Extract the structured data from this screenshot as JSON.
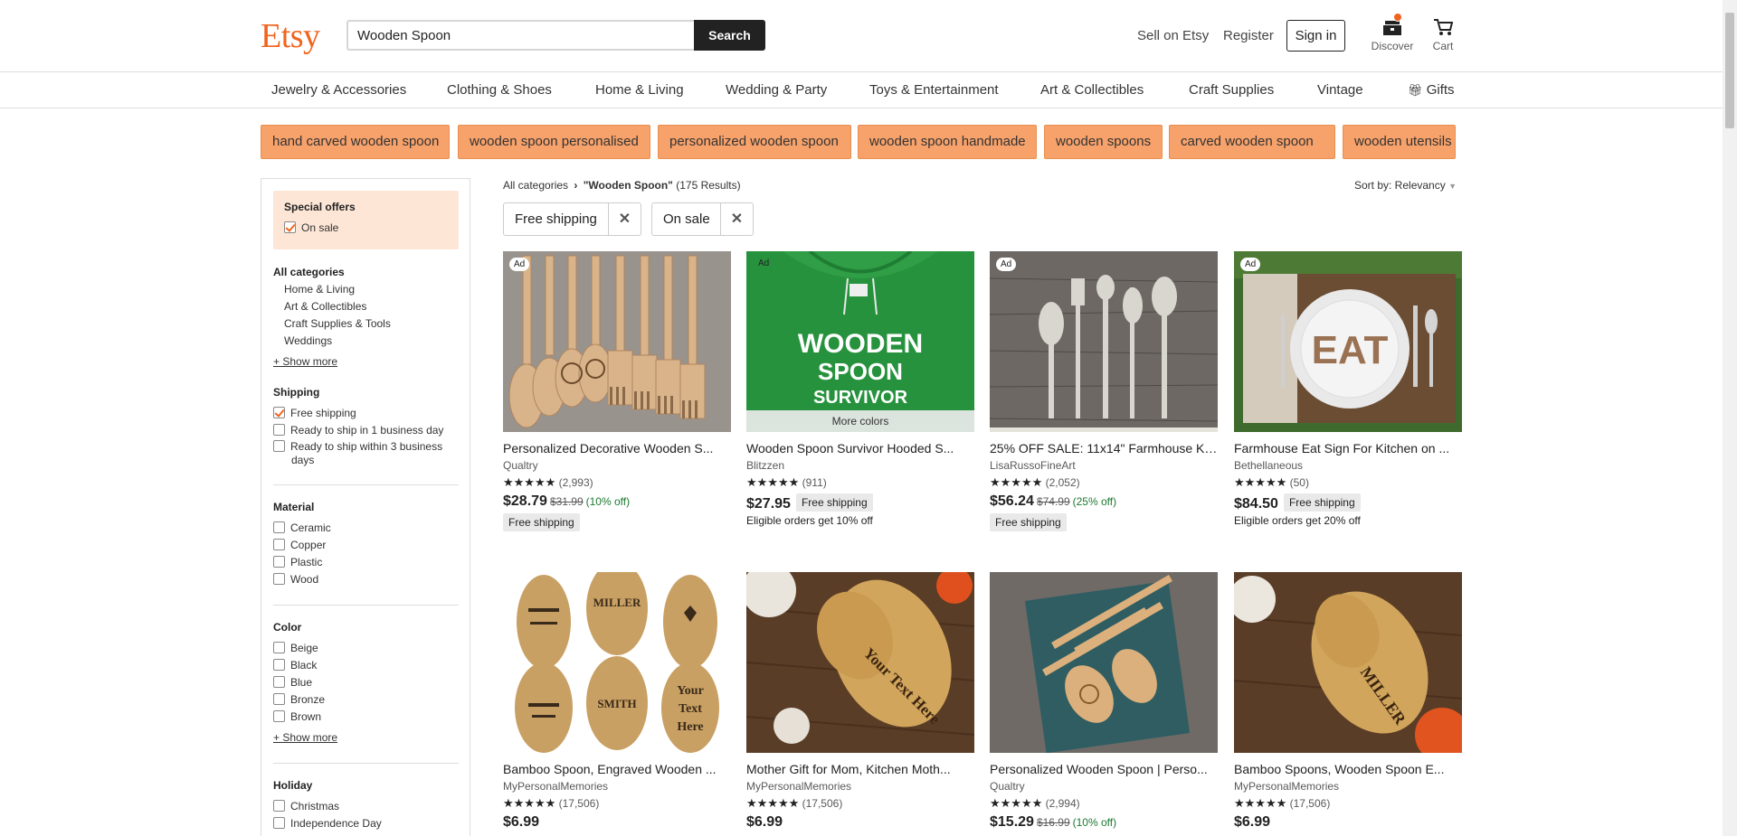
{
  "header": {
    "logo": "Etsy",
    "search_value": "Wooden Spoon",
    "search_button": "Search",
    "sell": "Sell on Etsy",
    "register": "Register",
    "signin": "Sign in",
    "discover": "Discover",
    "cart": "Cart"
  },
  "nav": [
    "Jewelry & Accessories",
    "Clothing & Shoes",
    "Home & Living",
    "Wedding & Party",
    "Toys & Entertainment",
    "Art & Collectibles",
    "Craft Supplies",
    "Vintage",
    "Gifts"
  ],
  "tags": [
    "hand carved wooden spoon",
    "wooden spoon personalised",
    "personalized wooden spoon",
    "wooden spoon handmade",
    "wooden spoons",
    "carved wooden spoon",
    "wooden utensils"
  ],
  "sidebar": {
    "special_offers": "Special offers",
    "on_sale": "On sale",
    "all_categories": "All categories",
    "categories": [
      "Home & Living",
      "Art & Collectibles",
      "Craft Supplies & Tools",
      "Weddings"
    ],
    "show_more": "+ Show more",
    "shipping_head": "Shipping",
    "shipping": [
      "Free shipping",
      "Ready to ship in 1 business day",
      "Ready to ship within 3 business",
      "days"
    ],
    "material_head": "Material",
    "materials": [
      "Ceramic",
      "Copper",
      "Plastic",
      "Wood"
    ],
    "color_head": "Color",
    "colors": [
      "Beige",
      "Black",
      "Blue",
      "Bronze",
      "Brown"
    ],
    "holiday_head": "Holiday",
    "holidays": [
      "Christmas",
      "Independence Day"
    ]
  },
  "main": {
    "crumb_all": "All categories",
    "crumb_sep": "›",
    "crumb_query": "\"Wooden Spoon\"",
    "crumb_count": "(175 Results)",
    "sort_label": "Sort by: Relevancy",
    "chips": [
      "Free shipping",
      "On sale"
    ],
    "ad": "Ad",
    "more_colors": "More colors"
  },
  "products": [
    {
      "title": "Personalized Decorative Wooden S...",
      "shop": "Qualtry",
      "stars": "★★★★★",
      "reviews": "(2,993)",
      "price": "$28.79",
      "orig": "$31.99",
      "disc": "(10% off)",
      "pill": "Free shipping",
      "eligible": ""
    },
    {
      "title": "Wooden Spoon Survivor Hooded S...",
      "shop": "Blitzzen",
      "stars": "★★★★★",
      "reviews": "(911)",
      "price": "$27.95",
      "orig": "",
      "disc": "",
      "pill": "Free shipping",
      "eligible": "Eligible orders get 10% off"
    },
    {
      "title": "25% OFF SALE: 11x14\" Farmhouse Ki...",
      "shop": "LisaRussoFineArt",
      "stars": "★★★★★",
      "reviews": "(2,052)",
      "price": "$56.24",
      "orig": "$74.99",
      "disc": "(25% off)",
      "pill": "Free shipping",
      "eligible": ""
    },
    {
      "title": "Farmhouse Eat Sign For Kitchen on ...",
      "shop": "Bethellaneous",
      "stars": "★★★★★",
      "reviews": "(50)",
      "price": "$84.50",
      "orig": "",
      "disc": "",
      "pill": "Free shipping",
      "eligible": "Eligible orders get 20% off"
    },
    {
      "title": "Bamboo Spoon, Engraved Wooden ...",
      "shop": "MyPersonalMemories",
      "stars": "★★★★★",
      "reviews": "(17,506)",
      "price": "$6.99",
      "orig": "",
      "disc": ""
    },
    {
      "title": "Mother Gift for Mom, Kitchen Moth...",
      "shop": "MyPersonalMemories",
      "stars": "★★★★★",
      "reviews": "(17,506)",
      "price": "$6.99",
      "orig": "",
      "disc": ""
    },
    {
      "title": "Personalized Wooden Spoon | Perso...",
      "shop": "Qualtry",
      "stars": "★★★★★",
      "reviews": "(2,994)",
      "price": "$15.29",
      "orig": "$16.99",
      "disc": "(10% off)"
    },
    {
      "title": "Bamboo Spoons, Wooden Spoon E...",
      "shop": "MyPersonalMemories",
      "stars": "★★★★★",
      "reviews": "(17,506)",
      "price": "$6.99",
      "orig": "",
      "disc": ""
    }
  ],
  "hoodie_text": [
    "WOODEN",
    "SPOON",
    "SURVIVOR"
  ],
  "sign_text": "EAT",
  "spoon_text": [
    "MILLER",
    "SMITH",
    "Your",
    "Text",
    "Here"
  ],
  "colors": {
    "brand": "#F1641E",
    "tag_bg": "#F7A26B",
    "special_bg": "#FDE6D6",
    "sale_green": "#1C7A30"
  }
}
